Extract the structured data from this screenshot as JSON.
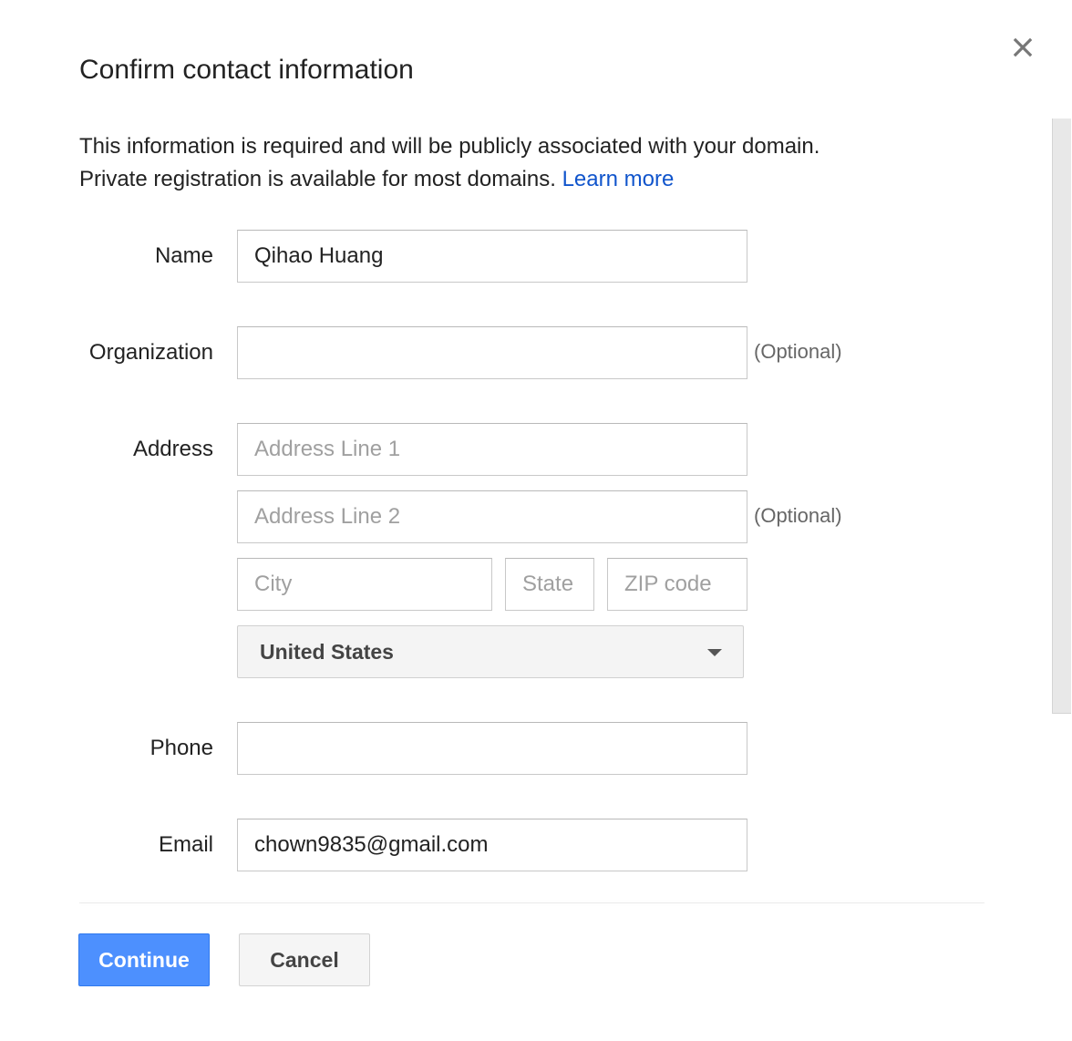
{
  "dialog": {
    "title": "Confirm contact information",
    "description_line1": "This information is required and will be publicly associated with your domain.",
    "description_line2": "Private registration is available for most domains.",
    "learn_more": "Learn more"
  },
  "form": {
    "name": {
      "label": "Name",
      "value": "Qihao Huang"
    },
    "organization": {
      "label": "Organization",
      "value": "",
      "optional": "(Optional)"
    },
    "address": {
      "label": "Address",
      "line1_placeholder": "Address Line 1",
      "line2_placeholder": "Address Line 2",
      "line2_optional": "(Optional)",
      "city_placeholder": "City",
      "state_placeholder": "State",
      "zip_placeholder": "ZIP code",
      "country": "United States"
    },
    "phone": {
      "label": "Phone",
      "value": ""
    },
    "email": {
      "label": "Email",
      "value": "chown9835@gmail.com"
    }
  },
  "buttons": {
    "continue": "Continue",
    "cancel": "Cancel"
  },
  "icons": {
    "close": "close-icon",
    "dropdown": "chevron-down-icon"
  },
  "colors": {
    "link": "#1155cc",
    "primary_button": "#4d90fe",
    "secondary_button": "#f5f5f5"
  }
}
